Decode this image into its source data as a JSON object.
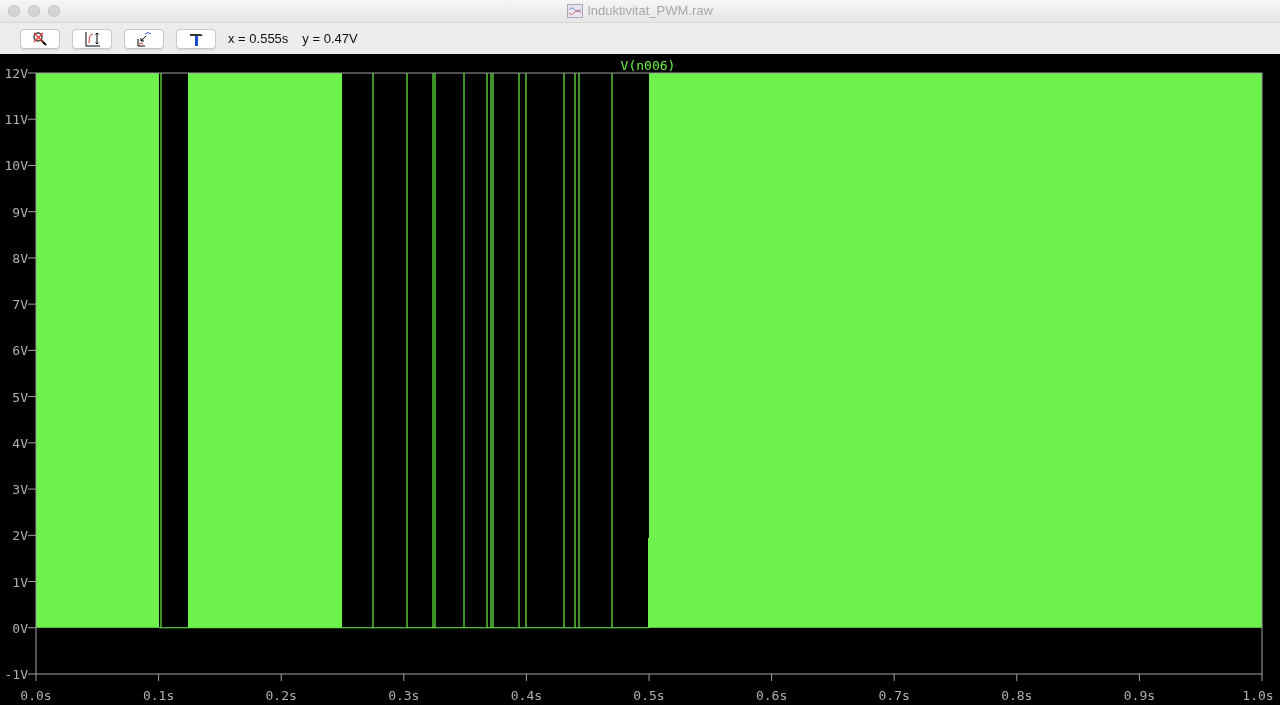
{
  "window": {
    "title": "Induktivitat_PWM.raw"
  },
  "toolbar": {
    "readouts": [
      "x = 0.555s",
      "y = 0.47V"
    ]
  },
  "plot": {
    "trace": "V(n006)",
    "y_ticks": [
      "12V",
      "11V",
      "10V",
      "9V",
      "8V",
      "7V",
      "6V",
      "5V",
      "4V",
      "3V",
      "2V",
      "1V",
      "0V",
      "-1V"
    ],
    "x_ticks": [
      "0.0s",
      "0.1s",
      "0.2s",
      "0.3s",
      "0.4s",
      "0.5s",
      "0.6s",
      "0.7s",
      "0.8s",
      "0.9s",
      "1.0s"
    ]
  }
}
